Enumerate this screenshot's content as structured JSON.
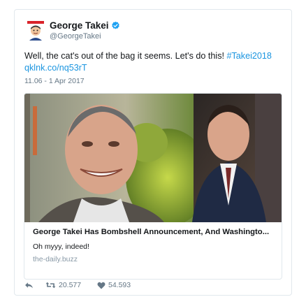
{
  "tweet": {
    "author": {
      "name": "George Takei",
      "handle": "@GeorgeTakei",
      "avatar_icon": "avatar-icon",
      "verified_icon": "verified-badge-icon"
    },
    "text": "Well, the cat's out of the bag it seems. Let's do this!",
    "hashtag": "#Takei2018",
    "link": "qklnk.co/nq53rT",
    "timestamp": "11.06 - 1 Apr 2017",
    "card": {
      "title": "George Takei Has Bombshell Announcement, And Washingto...",
      "description": "Oh myyy, indeed!",
      "domain": "the-daily.buzz"
    },
    "actions": {
      "reply_icon": "reply-icon",
      "retweet_icon": "retweet-icon",
      "retweet_count": "20.577",
      "like_icon": "heart-icon",
      "like_count": "54.593"
    }
  },
  "colors": {
    "link": "#1b95e0",
    "muted": "#657786",
    "border": "#e1e8ed",
    "verified": "#1da1f2"
  }
}
